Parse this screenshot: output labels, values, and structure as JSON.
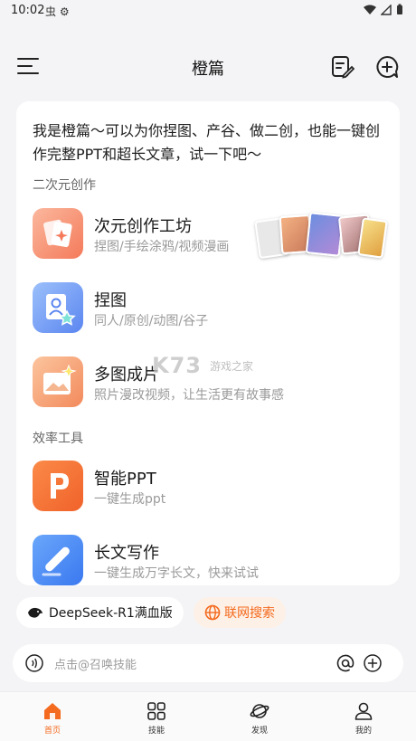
{
  "status": {
    "time": "10:02",
    "left_icons": "虫 ⚙"
  },
  "header": {
    "title": "橙篇"
  },
  "intro": "我是橙篇～可以为你捏图、产谷、做二创，也能一键创作完整PPT和超长文章，试一下吧～",
  "sections": {
    "creative": "二次元创作",
    "efficiency": "效率工具"
  },
  "features": [
    {
      "name": "次元创作工坊",
      "desc": "捏图/手绘涂鸦/视频漫画",
      "icon": "cards-icon"
    },
    {
      "name": "捏图",
      "desc": "同人/原创/动图/谷子",
      "icon": "portrait-star-icon"
    },
    {
      "name": "多图成片",
      "desc": "照片漫改视频，让生活更有故事感",
      "icon": "image-sparkle-icon"
    },
    {
      "name": "智能PPT",
      "desc": "一键生成ppt",
      "icon": "ppt-icon"
    },
    {
      "name": "长文写作",
      "desc": "一键生成万字长文，快来试试",
      "icon": "pen-icon"
    }
  ],
  "watermark": {
    "main": "K73",
    "sub": "游戏之家"
  },
  "chips": {
    "model": "DeepSeek-R1满血版",
    "web": "联网搜索"
  },
  "input": {
    "placeholder": "点击@召唤技能"
  },
  "tabs": [
    {
      "label": "首页",
      "icon": "home-icon",
      "active": true
    },
    {
      "label": "技能",
      "icon": "grid-icon",
      "active": false
    },
    {
      "label": "发现",
      "icon": "planet-icon",
      "active": false
    },
    {
      "label": "我的",
      "icon": "user-icon",
      "active": false
    }
  ],
  "colors": {
    "accent": "#f46a1e",
    "background": "#f4f4f6",
    "card": "#ffffff"
  }
}
